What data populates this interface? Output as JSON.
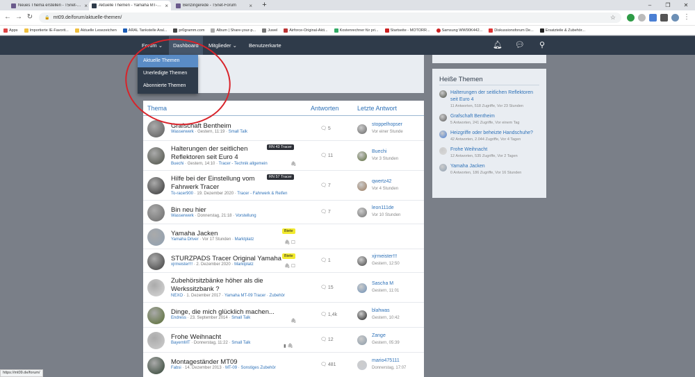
{
  "browser": {
    "tabs": [
      {
        "label": "Neues Thema erstellen - T5net-Foru...",
        "favcolor": "#6a5a8c"
      },
      {
        "label": "Aktuelle Themen - Yamaha MT-09 F...",
        "favcolor": "#6a5a8c"
      },
      {
        "label": "Benzingerede - T5net-Forum",
        "favcolor": "#6a5a8c"
      }
    ],
    "url": "mt09.de/forum/aktuelle-themen/",
    "bookmarks": [
      "Apps",
      "Importierte IE-Favorit...",
      "Aktuelle Lesezeichen",
      "ARAL Tankstelle Aral...",
      "pr0gramm.com",
      "Album | Share-your-p...",
      "Juwel",
      "Airforce-Original-Akti...",
      "Kostenrechner für pri...",
      "Startseite - MOTORR...",
      "Samsung WW90K442...",
      "Diskussionsforum De...",
      "Ersatzteile & Zubehör..."
    ]
  },
  "nav": {
    "forum": "Forum",
    "dashboard": "Dashboard",
    "members": "Mitglieder",
    "map": "Benutzerkarte"
  },
  "dropdown": [
    "Aktuelle Themen",
    "Unerledigte Themen",
    "Abonnierte Themen"
  ],
  "list": {
    "header": {
      "topic": "Thema",
      "replies": "Antworten",
      "last": "Letzte Antwort"
    },
    "threads": [
      {
        "title": "Grafschaft Bentheim",
        "title2": "",
        "user": "Wasserwerk",
        "date": "Gestern, 11:19",
        "forum": "Small Talk",
        "prefix": "",
        "replies": "5",
        "last_user": "stoppelhopser",
        "last_time": "Vor einer Stunde",
        "icons": ""
      },
      {
        "title": "Halterungen der seitlichen",
        "title2": "Reflektoren seit Euro 4",
        "user": "Buechi",
        "date": "Gestern, 14:10",
        "forum": "Tracer - Technik allgemein",
        "prefix": "RN 43 Tracer",
        "replies": "11",
        "last_user": "Buechi",
        "last_time": "Vor 3 Stunden",
        "icons": "🖇"
      },
      {
        "title": "Hilfe bei der Einstellung vom",
        "title2": "Fahrwerk Tracer",
        "user": "To-racer900",
        "date": "19. Dezember 2020",
        "forum": "Tracer - Fahrwerk & Reifen",
        "prefix": "RN 57 Tracer",
        "replies": "7",
        "last_user": "qwertz42",
        "last_time": "Vor 4 Stunden",
        "icons": ""
      },
      {
        "title": "Bin neu hier",
        "title2": "",
        "user": "Wasserwerk",
        "date": "Donnerstag, 21:18",
        "forum": "Vorstellung",
        "prefix": "",
        "replies": "7",
        "last_user": "leon111de",
        "last_time": "Vor 10 Stunden",
        "icons": ""
      },
      {
        "title": "Yamaha Jacken",
        "title2": "",
        "user": "Yamaha Driver",
        "date": "Vor 17 Stunden",
        "forum": "Marktplatz",
        "prefix": "Biete",
        "replies": "",
        "last_user": "",
        "last_time": "",
        "icons": "🖇 ☐"
      },
      {
        "title": "STURZPADS Tracer Original Yamaha",
        "title2": "",
        "user": "xjrmeister!!!",
        "date": "2. Dezember 2020",
        "forum": "Marktplatz",
        "prefix": "Biete",
        "replies": "1",
        "last_user": "xjrmeister!!!",
        "last_time": "Gestern, 12:50",
        "icons": "🖇 ☐"
      },
      {
        "title": "Zubehörsitzbänke höher als die",
        "title2": "Werkssitzbank ?",
        "user": "NEXO",
        "date": "1. Dezember 2017",
        "forum": "Yamaha MT-09 Tracer · Zubehör",
        "prefix": "",
        "replies": "15",
        "last_user": "Sascha M",
        "last_time": "Gestern, 11:01",
        "icons": ""
      },
      {
        "title": "Dinge, die mich glücklich machen...",
        "title2": "",
        "user": "Endress",
        "date": "23. September 2014",
        "forum": "Small Talk",
        "prefix": "",
        "replies": "1,4k",
        "last_user": "blahwas",
        "last_time": "Gestern, 10:42",
        "icons": "🖇"
      },
      {
        "title": "Frohe Weihnacht",
        "title2": "",
        "user": "BayernMT",
        "date": "Donnerstag, 11:22",
        "forum": "Small Talk",
        "prefix": "",
        "replies": "12",
        "last_user": "Zange",
        "last_time": "Gestern, 05:39",
        "icons": "▮ 🖇"
      },
      {
        "title": "Montageständer MT09",
        "title2": "",
        "user": "Fabsi",
        "date": "14. Dezember 2013",
        "forum": "MT-09 · Sonstiges Zubehör",
        "prefix": "",
        "replies": "481",
        "last_user": "mario475111",
        "last_time": "Donnerstag, 17:07",
        "icons": ""
      }
    ]
  },
  "sidebar": {
    "title": "Heiße Themen",
    "items": [
      {
        "title": "Halterungen der seitlichen Reflektoren seit Euro 4",
        "meta": "11 Antworten, 518 Zugriffe, Vor 23 Stunden"
      },
      {
        "title": "Grafschaft Bentheim",
        "meta": "5 Antworten, 241 Zugriffe, Vor einem Tag"
      },
      {
        "title": "Heizgriffe oder beheizte Handschuhe?",
        "meta": "42 Antworten, 2.044 Zugriffe, Vor 4 Tagen"
      },
      {
        "title": "Frohe Weihnacht",
        "meta": "12 Antworten, 535 Zugriffe, Vor 2 Tagen"
      },
      {
        "title": "Yamaha Jacken",
        "meta": "0 Antworten, 186 Zugriffe, Vor 16 Stunden"
      }
    ]
  },
  "status": "https://mt09.de/forum/"
}
